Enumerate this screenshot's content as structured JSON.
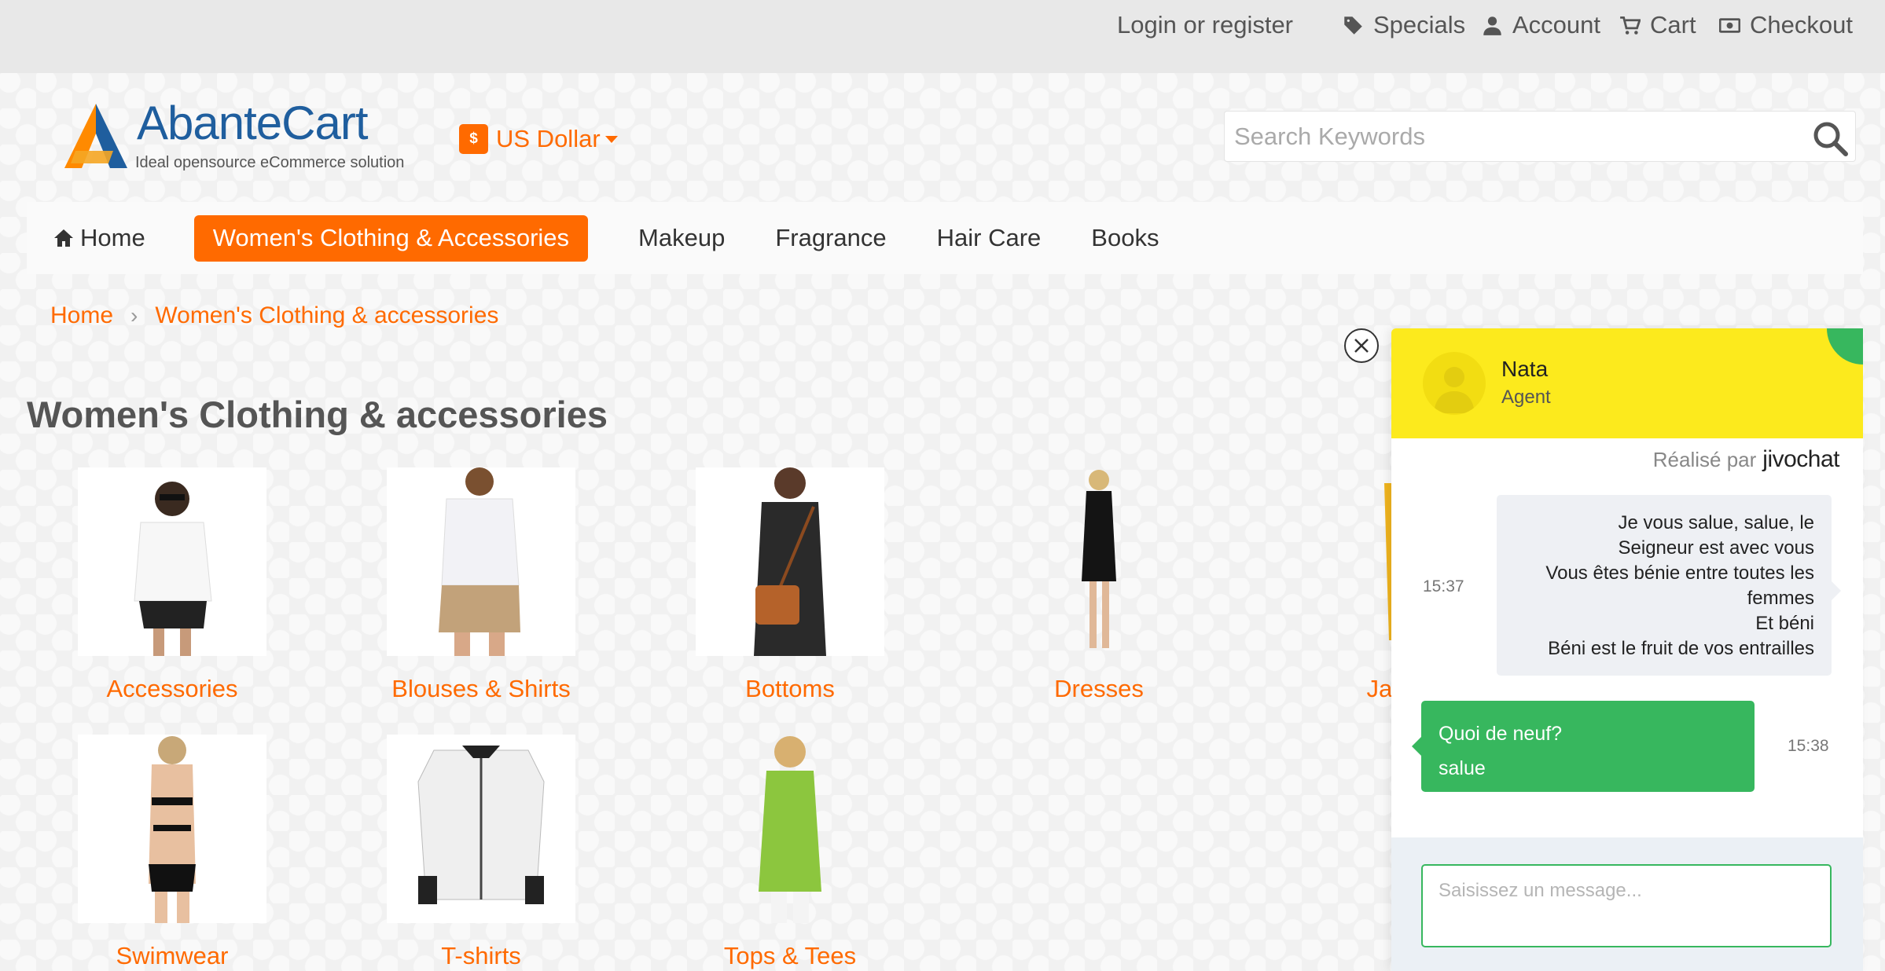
{
  "topbar": {
    "login": "Login or register",
    "links": [
      {
        "label": "Specials",
        "icon": "tag-icon"
      },
      {
        "label": "Account",
        "icon": "user-icon"
      },
      {
        "label": "Cart",
        "icon": "cart-icon"
      },
      {
        "label": "Checkout",
        "icon": "money-icon"
      }
    ]
  },
  "header": {
    "logo_text": "AbanteCart",
    "logo_sub": "Ideal opensource eCommerce solution",
    "currency_symbol": "$",
    "currency_label": "US Dollar",
    "search_placeholder": "Search Keywords"
  },
  "nav": {
    "items": [
      "Home",
      "Women's Clothing & Accessories",
      "Makeup",
      "Fragrance",
      "Hair Care",
      "Books"
    ],
    "active_index": 1
  },
  "breadcrumb": {
    "home": "Home",
    "current": "Women's Clothing & accessories"
  },
  "page_title": "Women's Clothing & accessories",
  "categories": [
    "Accessories",
    "Blouses & Shirts",
    "Bottoms",
    "Dresses",
    "Jackets",
    "Swimwear",
    "T-shirts",
    "Tops & Tees"
  ],
  "chat": {
    "agent_name": "Nata",
    "agent_role": "Agent",
    "powered_by": "Réalisé par",
    "powered_brand": "jivochat",
    "agent_message": [
      "Je vous salue, salue, le",
      "Seigneur est avec vous",
      "Vous êtes bénie entre toutes les",
      "femmes",
      "Et béni",
      "Béni est le fruit de vos entrailles"
    ],
    "agent_time": "15:37",
    "user_message": [
      "Quoi de neuf?",
      "salue"
    ],
    "user_time": "15:38",
    "input_placeholder": "Saisissez un message..."
  },
  "colors": {
    "accent": "#ff6a00",
    "chat_header": "#fcea1d",
    "chat_green": "#37b75e",
    "logo_blue": "#1f5e9e"
  }
}
